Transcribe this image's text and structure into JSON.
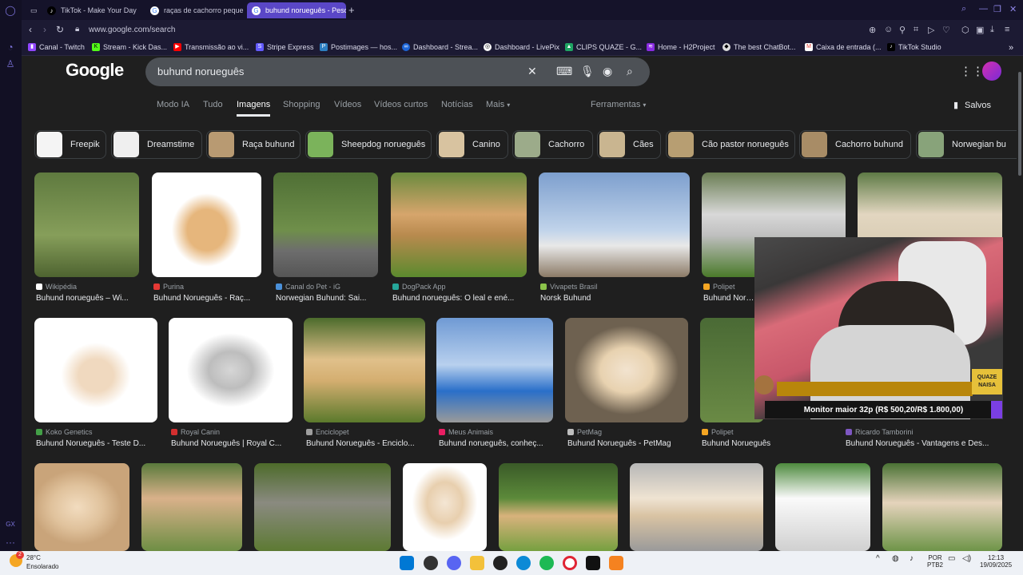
{
  "browser": {
    "tabs": [
      {
        "label": "TikTok - Make Your Day",
        "active": false
      },
      {
        "label": "raças de cachorro peque",
        "active": false
      },
      {
        "label": "buhund norueguês - Pesq",
        "active": true
      }
    ],
    "url": "www.google.com/search",
    "bookmarks": [
      "Canal - Twitch",
      "Stream - Kick Das...",
      "Transmissão ao vi...",
      "Stripe Express",
      "Postimages — hos...",
      "Dashboard - Strea...",
      "Dashboard - LivePix",
      "CLIPS QUAZE - G...",
      "Home - H2Project",
      "The best ChatBot...",
      "Caixa de entrada (...",
      "TikTok Studio"
    ],
    "sidebar_label": "GX"
  },
  "google": {
    "logo": "Google",
    "query": "buhund norueguês",
    "filters": [
      "Modo IA",
      "Tudo",
      "Imagens",
      "Shopping",
      "Vídeos",
      "Vídeos curtos",
      "Notícias",
      "Mais"
    ],
    "active_filter": "Imagens",
    "tools": "Ferramentas",
    "saved": "Salvos",
    "chips": [
      "Freepik",
      "Dreamstime",
      "Raça buhund",
      "Sheepdog norueguês",
      "Canino",
      "Cachorro",
      "Cães",
      "Cão pastor norueguês",
      "Cachorro buhund",
      "Norwegian bu"
    ],
    "row1": [
      {
        "source": "Wikipédia",
        "caption": "Buhund norueguês – Wi..."
      },
      {
        "source": "Purina",
        "caption": "Buhund Norueguês - Raç..."
      },
      {
        "source": "Canal do Pet - iG",
        "caption": "Norwegian Buhund: Sai..."
      },
      {
        "source": "DogPack App",
        "caption": "Buhund norueguês: O leal e ené..."
      },
      {
        "source": "Vivapets Brasil",
        "caption": "Norsk Buhund"
      },
      {
        "source": "Polipet",
        "caption": "Buhund Norue..."
      }
    ],
    "row2": [
      {
        "source": "Koko Genetics",
        "caption": "Buhund Norueguês - Teste D..."
      },
      {
        "source": "Royal Canin",
        "caption": "Buhund Norueguês | Royal C..."
      },
      {
        "source": "Enciclopet",
        "caption": "Buhund Norueguês - Enciclo..."
      },
      {
        "source": "Meus Animais",
        "caption": "Buhund norueguês, conheç..."
      },
      {
        "source": "PetMag",
        "caption": "Buhund Norueguês - PetMag"
      },
      {
        "source": "Polipet",
        "caption": "Buhund Norueguês"
      },
      {
        "source": "Ricardo Tamborini",
        "caption": "Buhund Norueguês - Vantagens e Des..."
      }
    ]
  },
  "overlay": {
    "text": "Monitor maior 32p (R$ 500,20/R$ 1.800,00)",
    "logo": "QUAZE NAISA"
  },
  "taskbar": {
    "temp": "28°C",
    "condition": "Ensolarado",
    "lang1": "POR",
    "lang2": "PTB2",
    "time": "12:13",
    "date": "19/09/2025",
    "badge": "2"
  }
}
